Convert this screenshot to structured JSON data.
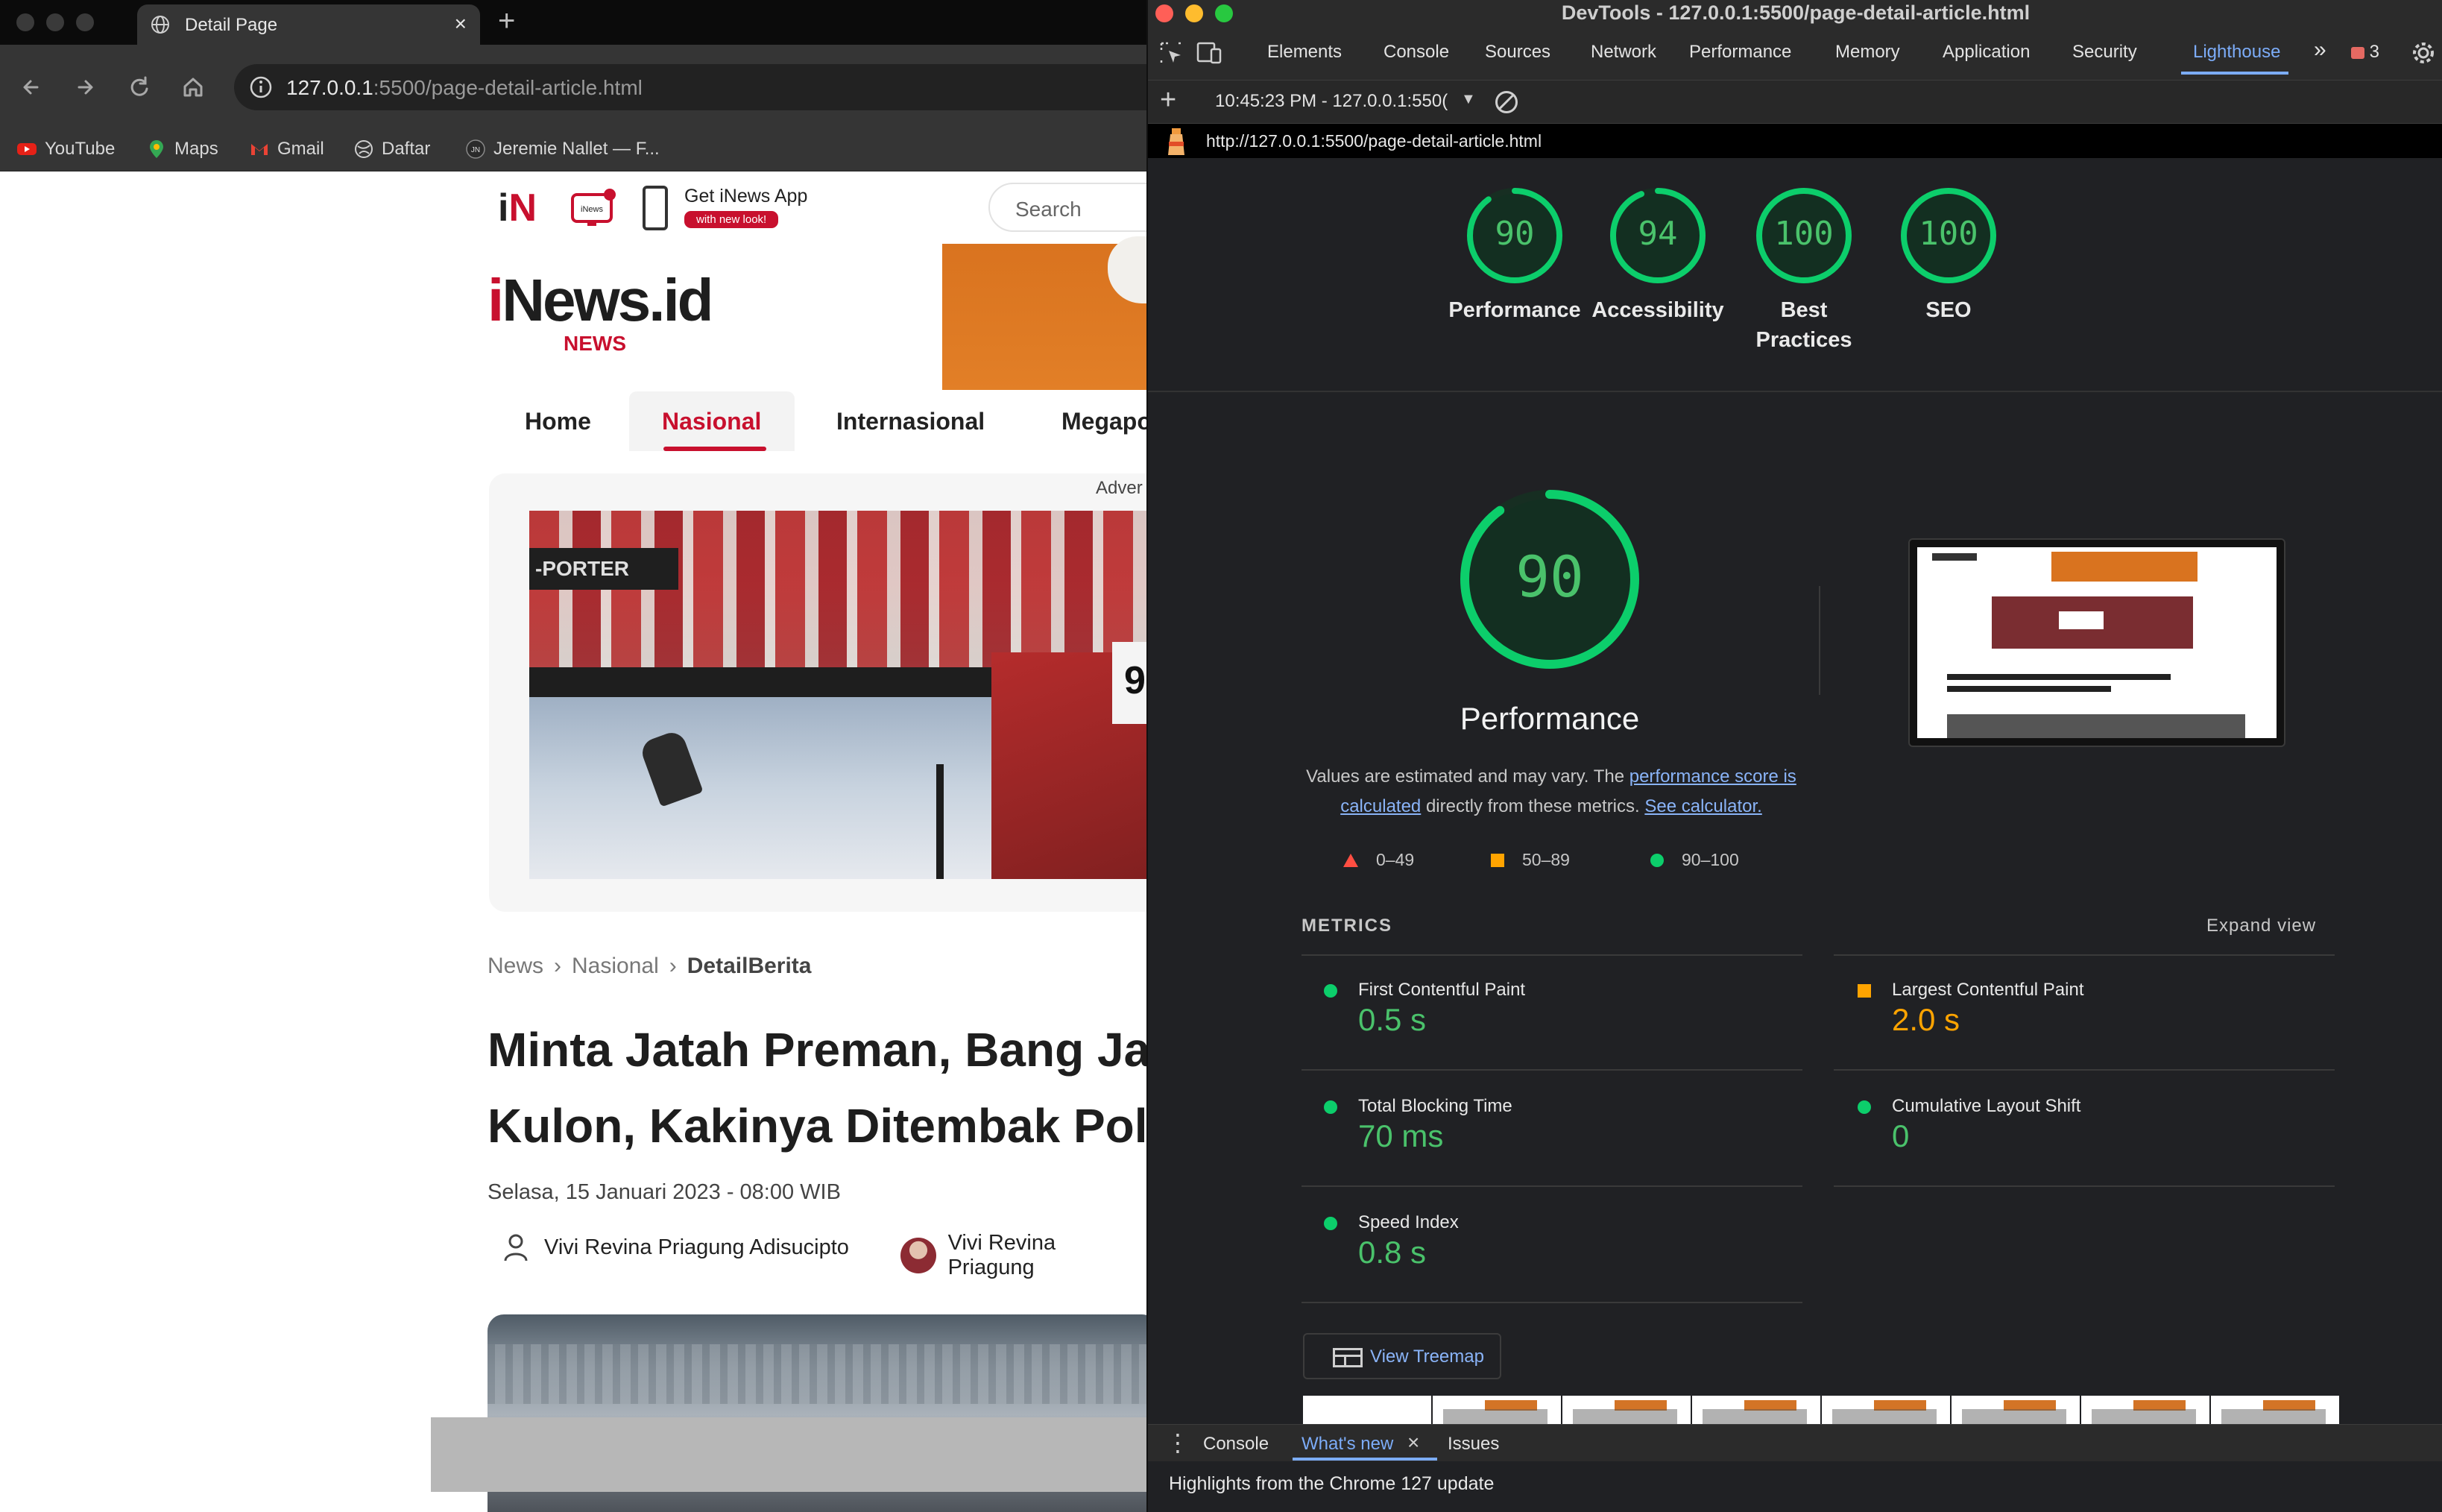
{
  "browser": {
    "tab_title": "Detail Page",
    "close_glyph": "×",
    "new_tab_glyph": "+",
    "url_host": "127.0.0.1",
    "url_rest": ":5500/page-detail-article.html",
    "bookmarks": [
      "YouTube",
      "Maps",
      "Gmail",
      "Daftar",
      "Jeremie Nallet — F..."
    ]
  },
  "site": {
    "logo_in": "i",
    "logo_n": "N",
    "tv_label": "iNews",
    "get_app": "Get iNews App",
    "new_look": "with new look!",
    "search_placeholder": "Search",
    "brand_i": "i",
    "brand_rest": "News.id",
    "brand_sub": "NEWS",
    "nav": [
      "Home",
      "Nasional",
      "Internasional",
      "Megapo"
    ],
    "ad_label": "Adver",
    "ad_porter": "-PORTER",
    "ad_nine": "9",
    "breadcrumb": [
      "News",
      "Nasional",
      "DetailBerita"
    ],
    "crumb_sep": "›",
    "headline_line1": "Minta Jatah Preman, Bang Ja",
    "headline_line2": "Kulon, Kakinya Ditembak Pol",
    "dateline": "Selasa, 15 Januari 2023 - 08:00 WIB",
    "author1": "Vivi Revina Priagung Adisucipto",
    "author2": "Vivi Revina Priagung"
  },
  "devtools": {
    "window_title": "DevTools - 127.0.0.1:5500/page-detail-article.html",
    "tabs": [
      "Elements",
      "Console",
      "Sources",
      "Network",
      "Performance",
      "Memory",
      "Application",
      "Security",
      "Lighthouse"
    ],
    "more_glyph": "»",
    "issues_count": "3",
    "session_label": "10:45:23 PM - 127.0.0.1:550(",
    "report_url": "http://127.0.0.1:5500/page-detail-article.html",
    "scores": [
      {
        "value": "90",
        "label": "Performance"
      },
      {
        "value": "94",
        "label": "Accessibility"
      },
      {
        "value": "100",
        "label": "Best Practices"
      },
      {
        "value": "100",
        "label": "SEO"
      }
    ],
    "score_fractions": [
      0.9,
      0.94,
      1.0,
      1.0
    ],
    "perf_big_score": "90",
    "perf_title": "Performance",
    "perf_note_pre": "Values are estimated and may vary. The ",
    "perf_note_link": "performance score is calculated",
    "perf_note_mid": " directly from these metrics. ",
    "perf_note_link2": "See calculator.",
    "legend": [
      "0–49",
      "50–89",
      "90–100"
    ],
    "metrics_heading": "METRICS",
    "expand_view": "Expand view",
    "metrics": [
      {
        "name": "First Contentful Paint",
        "value": "0.5 s",
        "status": "good"
      },
      {
        "name": "Largest Contentful Paint",
        "value": "2.0 s",
        "status": "average"
      },
      {
        "name": "Total Blocking Time",
        "value": "70 ms",
        "status": "good"
      },
      {
        "name": "Cumulative Layout Shift",
        "value": "0",
        "status": "good"
      },
      {
        "name": "Speed Index",
        "value": "0.8 s",
        "status": "good"
      }
    ],
    "view_treemap": "View Treemap",
    "drawer_tabs": [
      "Console",
      "What's new",
      "Issues"
    ],
    "drawer_close": "×",
    "drawer_text": "Highlights from the Chrome 127 update",
    "colors": {
      "good": "#0cce6b",
      "good_text": "#4ac26b",
      "average": "#ffa400",
      "poor": "#ff4e42",
      "link": "#8ab4f8",
      "accent": "#7cacf8"
    }
  }
}
